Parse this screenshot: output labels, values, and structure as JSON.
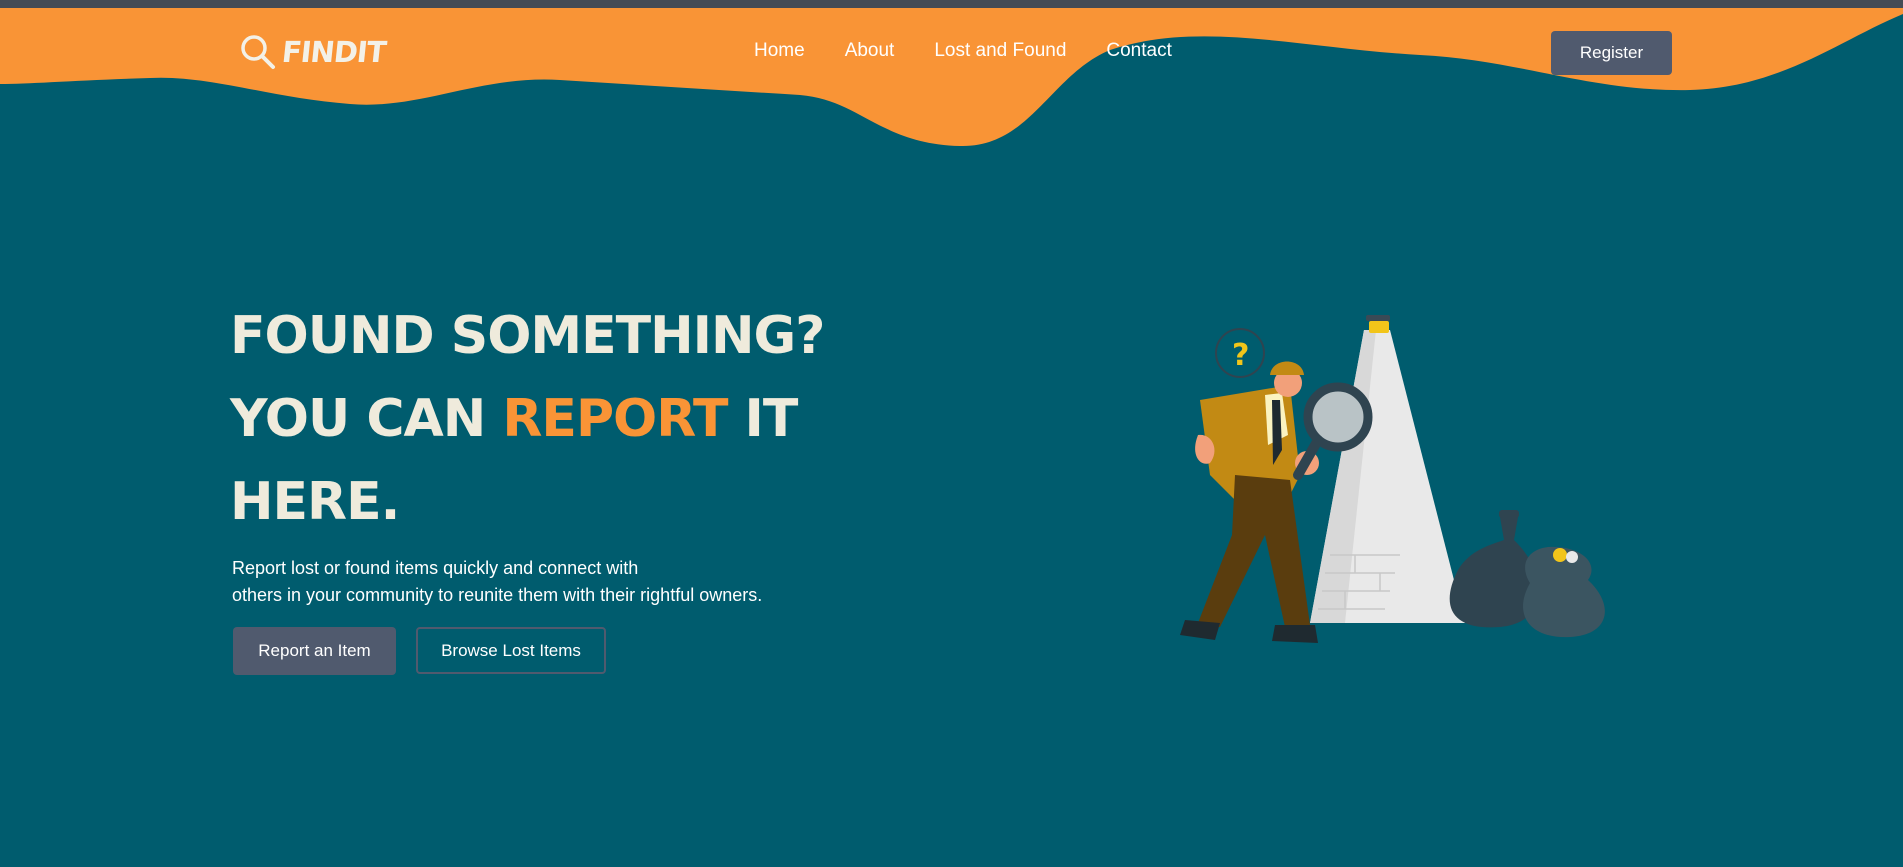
{
  "colors": {
    "background": "#005c6e",
    "header_wave": "#f99436",
    "accent": "#f99436",
    "button": "#505a6e",
    "title_text": "#efebdc"
  },
  "brand": {
    "name": "FINDIT",
    "icon": "magnifier-icon"
  },
  "nav": {
    "items": [
      {
        "label": "Home"
      },
      {
        "label": "About"
      },
      {
        "label": "Lost and Found"
      },
      {
        "label": "Contact"
      }
    ],
    "register_label": "Register"
  },
  "hero": {
    "title_part1": "FOUND SOMETHING?",
    "title_part2": "YOU CAN",
    "title_highlight": "REPORT",
    "title_part3": "IT HERE.",
    "description_line1": "Report lost or found items quickly and connect with",
    "description_line2": "others in your community to reunite them with their rightful owners.",
    "primary_button": "Report an Item",
    "secondary_button": "Browse Lost Items"
  },
  "illustration": {
    "subject": "detective-with-magnifier",
    "question_mark": "?"
  }
}
